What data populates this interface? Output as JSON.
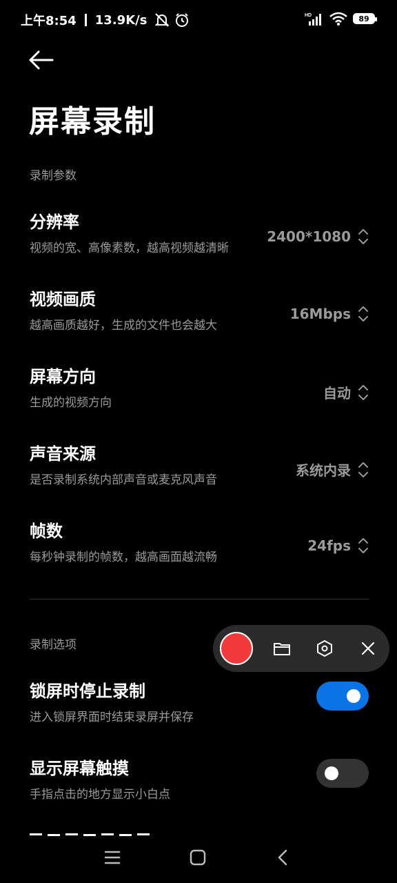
{
  "status": {
    "time": "上午8:54",
    "speed": "13.9K/s",
    "battery": "89"
  },
  "page": {
    "title": "屏幕录制"
  },
  "sections": {
    "params": "录制参数",
    "options": "录制选项"
  },
  "params": [
    {
      "title": "分辨率",
      "sub": "视频的宽、高像素数，越高视频越清晰",
      "value": "2400*1080"
    },
    {
      "title": "视频画质",
      "sub": "越高画质越好，生成的文件也会越大",
      "value": "16Mbps"
    },
    {
      "title": "屏幕方向",
      "sub": "生成的视频方向",
      "value": "自动"
    },
    {
      "title": "声音来源",
      "sub": "是否录制系统内部声音或麦克风声音",
      "value": "系统内录"
    },
    {
      "title": "帧数",
      "sub": "每秒钟录制的帧数，越高画面越流畅",
      "value": "24fps"
    }
  ],
  "options": [
    {
      "title": "锁屏时停止录制",
      "sub": "进入锁屏界面时结束录屏并保存",
      "enabled": true
    },
    {
      "title": "显示屏幕触摸",
      "sub": "手指点击的地方显示小白点",
      "enabled": false
    }
  ],
  "colors": {
    "accent": "#0a73e6",
    "record": "#f23a3c"
  },
  "icons": {
    "back": "arrow-left-icon",
    "folder": "folder-icon",
    "settings": "hexagon-settings-icon",
    "close": "close-icon"
  }
}
